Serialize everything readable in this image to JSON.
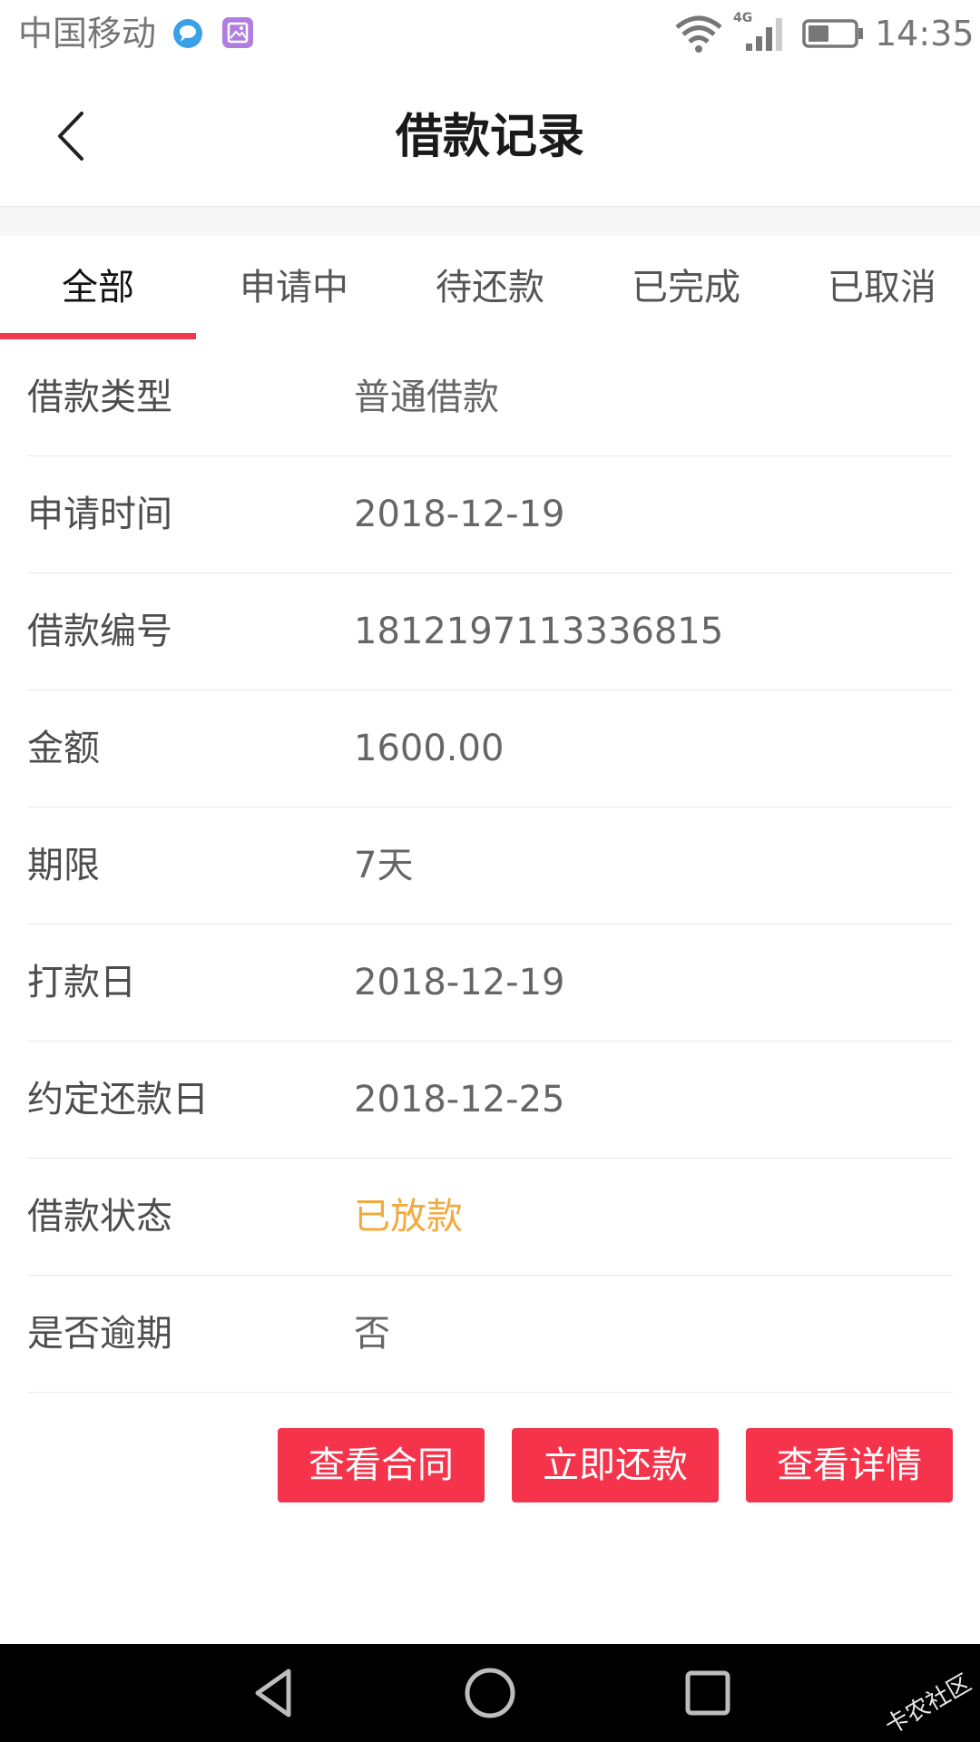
{
  "status_bar": {
    "carrier": "中国移动",
    "network": "4G",
    "time": "14:35",
    "icons": [
      "chat-bubble-icon",
      "gallery-icon",
      "wifi-icon",
      "signal-icon",
      "battery-icon"
    ]
  },
  "header": {
    "title": "借款记录",
    "back_icon": "chevron-left-icon"
  },
  "tabs": [
    {
      "label": "全部",
      "active": true
    },
    {
      "label": "申请中",
      "active": false
    },
    {
      "label": "待还款",
      "active": false
    },
    {
      "label": "已完成",
      "active": false
    },
    {
      "label": "已取消",
      "active": false
    }
  ],
  "details": [
    {
      "label": "借款类型",
      "value": "普通借款"
    },
    {
      "label": "申请时间",
      "value": "2018-12-19"
    },
    {
      "label": "借款编号",
      "value": "1812197113336815"
    },
    {
      "label": "金额",
      "value": "1600.00"
    },
    {
      "label": "期限",
      "value": "7天"
    },
    {
      "label": "打款日",
      "value": "2018-12-19"
    },
    {
      "label": "约定还款日",
      "value": "2018-12-25"
    },
    {
      "label": "借款状态",
      "value": "已放款"
    },
    {
      "label": "是否逾期",
      "value": "否"
    }
  ],
  "actions": {
    "view_contract": "查看合同",
    "repay_now": "立即还款",
    "view_details": "查看详情"
  },
  "colors": {
    "accent": "#f5344c",
    "tab_indicator": "#f0384e",
    "status_text": "#f4a93b",
    "nav_bar": "#000000"
  },
  "nav_bar": {
    "icons": [
      "back-triangle-icon",
      "home-circle-icon",
      "recents-square-icon"
    ],
    "watermark": "卡农社区"
  }
}
